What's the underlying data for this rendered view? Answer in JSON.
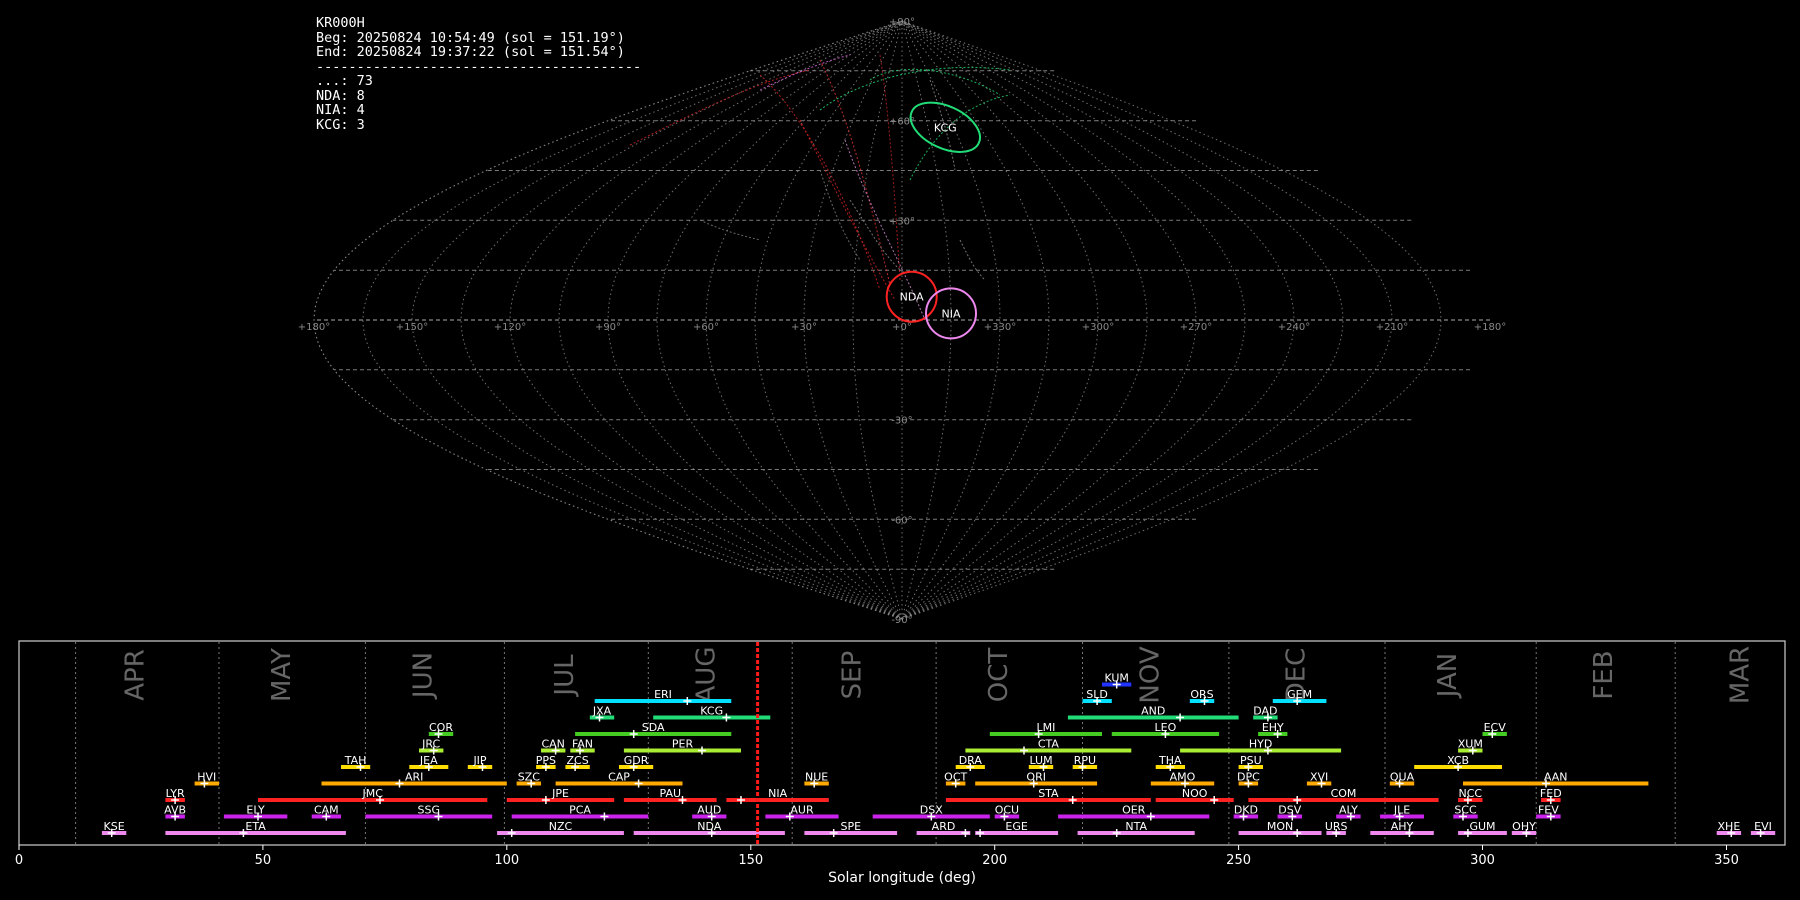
{
  "header": {
    "station": "KR000H",
    "beg": "Beg: 20250824 10:54:49 (sol = 151.19°)",
    "end": "End: 20250824 19:37:22 (sol = 151.54°)",
    "rule": "----------------------------------------",
    "counts": [
      {
        "code": "...",
        "n": "73"
      },
      {
        "code": "NDA",
        "n": "8"
      },
      {
        "code": "NIA",
        "n": "4"
      },
      {
        "code": "KCG",
        "n": "3"
      }
    ]
  },
  "chart_data": [
    {
      "type": "sky-map",
      "projection": "sinusoidal",
      "lon_ticks": [
        "+180°",
        "+150°",
        "+120°",
        "+90°",
        "+60°",
        "+30°",
        "+0°",
        "+330°",
        "+300°",
        "+270°",
        "+240°",
        "+210°",
        "+180°"
      ],
      "lat_ticks": [
        "+90°",
        "+60°",
        "+30°",
        "-30°",
        "-60°",
        "-90°"
      ],
      "radiants": [
        {
          "code": "KCG",
          "lon": 335,
          "lat": 58,
          "color": "#22dd77"
        },
        {
          "code": "NDA",
          "lon": 357,
          "lat": 7,
          "color": "#ff2222"
        },
        {
          "code": "NIA",
          "lon": 345,
          "lat": 2,
          "color": "#ee88ee"
        }
      ]
    },
    {
      "type": "timeline",
      "xlabel": "Solar longitude (deg)",
      "xlim": [
        0,
        362
      ],
      "x_ticks": [
        0,
        50,
        100,
        150,
        200,
        250,
        300,
        350
      ],
      "current_sol": 151.4,
      "months": [
        {
          "name": "APR",
          "start": 11.6,
          "center": 24
        },
        {
          "name": "MAY",
          "start": 41,
          "center": 54
        },
        {
          "name": "JUN",
          "start": 71,
          "center": 83
        },
        {
          "name": "JUL",
          "start": 99.5,
          "center": 112
        },
        {
          "name": "AUG",
          "start": 129,
          "center": 141
        },
        {
          "name": "SEP",
          "start": 158.5,
          "center": 171
        },
        {
          "name": "OCT",
          "start": 188,
          "center": 201
        },
        {
          "name": "NOV",
          "start": 218,
          "center": 232
        },
        {
          "name": "DEC",
          "start": 248,
          "center": 262
        },
        {
          "name": "JAN",
          "start": 280,
          "center": 293
        },
        {
          "name": "FEB",
          "start": 311,
          "center": 325
        },
        {
          "name": "MAR",
          "start": 339.5,
          "center": 353
        }
      ],
      "showers": [
        {
          "code": "KUM",
          "start": 222,
          "end": 228,
          "peak": 225,
          "row": 9,
          "color": "#2233ff"
        },
        {
          "code": "ERI",
          "start": 118,
          "end": 146,
          "peak": 137,
          "row": 8,
          "color": "#00e0ff"
        },
        {
          "code": "SLD",
          "start": 218,
          "end": 224,
          "peak": 221,
          "row": 8,
          "color": "#00e0ff"
        },
        {
          "code": "ORS",
          "start": 240,
          "end": 245,
          "peak": 243,
          "row": 8,
          "color": "#00e0ff"
        },
        {
          "code": "GEM",
          "start": 257,
          "end": 268,
          "peak": 262,
          "row": 8,
          "color": "#00e0ff"
        },
        {
          "code": "JXA",
          "start": 117,
          "end": 122,
          "peak": 119,
          "row": 7,
          "color": "#22dd77"
        },
        {
          "code": "KCG",
          "start": 130,
          "end": 154,
          "peak": 145,
          "row": 7,
          "color": "#22dd77"
        },
        {
          "code": "AND",
          "start": 215,
          "end": 250,
          "peak": 238,
          "row": 7,
          "color": "#22dd77"
        },
        {
          "code": "DAD",
          "start": 253,
          "end": 258,
          "peak": 256,
          "row": 7,
          "color": "#22dd77"
        },
        {
          "code": "COR",
          "start": 84,
          "end": 89,
          "peak": 86,
          "row": 6,
          "color": "#44cc22"
        },
        {
          "code": "SDA",
          "start": 114,
          "end": 146,
          "peak": 126,
          "row": 6,
          "color": "#44cc22"
        },
        {
          "code": "LMI",
          "start": 199,
          "end": 222,
          "peak": 209,
          "row": 6,
          "color": "#44cc22"
        },
        {
          "code": "LEO",
          "start": 224,
          "end": 246,
          "peak": 235,
          "row": 6,
          "color": "#44cc22"
        },
        {
          "code": "EHY",
          "start": 254,
          "end": 260,
          "peak": 258,
          "row": 6,
          "color": "#44cc22"
        },
        {
          "code": "ECV",
          "start": 300,
          "end": 305,
          "peak": 302,
          "row": 6,
          "color": "#44cc22"
        },
        {
          "code": "JRC",
          "start": 82,
          "end": 87,
          "peak": 85,
          "row": 5,
          "color": "#aaee33"
        },
        {
          "code": "CAN",
          "start": 107,
          "end": 112,
          "peak": 110,
          "row": 5,
          "color": "#aaee33"
        },
        {
          "code": "FAN",
          "start": 113,
          "end": 118,
          "peak": 115,
          "row": 5,
          "color": "#aaee33"
        },
        {
          "code": "PER",
          "start": 124,
          "end": 148,
          "peak": 140,
          "row": 5,
          "color": "#aaee33"
        },
        {
          "code": "CTA",
          "start": 194,
          "end": 228,
          "peak": 206,
          "row": 5,
          "color": "#aaee33"
        },
        {
          "code": "HYD",
          "start": 238,
          "end": 271,
          "peak": 256,
          "row": 5,
          "color": "#aaee33"
        },
        {
          "code": "XUM",
          "start": 295,
          "end": 300,
          "peak": 298,
          "row": 5,
          "color": "#aaee33"
        },
        {
          "code": "TAH",
          "start": 66,
          "end": 72,
          "peak": 70,
          "row": 4,
          "color": "#ffdd00"
        },
        {
          "code": "JEA",
          "start": 80,
          "end": 88,
          "peak": 84,
          "row": 4,
          "color": "#ffdd00"
        },
        {
          "code": "JIP",
          "start": 92,
          "end": 97,
          "peak": 95,
          "row": 4,
          "color": "#ffdd00"
        },
        {
          "code": "PPS",
          "start": 106,
          "end": 110,
          "peak": 108,
          "row": 4,
          "color": "#ffdd00"
        },
        {
          "code": "ZCS",
          "start": 112,
          "end": 117,
          "peak": 114,
          "row": 4,
          "color": "#ffdd00"
        },
        {
          "code": "GDR",
          "start": 123,
          "end": 130,
          "peak": 126,
          "row": 4,
          "color": "#ffdd00"
        },
        {
          "code": "DRA",
          "start": 192,
          "end": 198,
          "peak": 195,
          "row": 4,
          "color": "#ffdd00"
        },
        {
          "code": "LUM",
          "start": 207,
          "end": 212,
          "peak": 210,
          "row": 4,
          "color": "#ffdd00"
        },
        {
          "code": "RPU",
          "start": 216,
          "end": 221,
          "peak": 218,
          "row": 4,
          "color": "#ffdd00"
        },
        {
          "code": "THA",
          "start": 233,
          "end": 239,
          "peak": 236,
          "row": 4,
          "color": "#ffdd00"
        },
        {
          "code": "PSU",
          "start": 250,
          "end": 255,
          "peak": 252,
          "row": 4,
          "color": "#ffdd00"
        },
        {
          "code": "XCB",
          "start": 286,
          "end": 304,
          "peak": 295,
          "row": 4,
          "color": "#ffdd00"
        },
        {
          "code": "HVI",
          "start": 36,
          "end": 41,
          "peak": 38,
          "row": 3,
          "color": "#ffaa00"
        },
        {
          "code": "ARI",
          "start": 62,
          "end": 100,
          "peak": 78,
          "row": 3,
          "color": "#ffaa00"
        },
        {
          "code": "SZC",
          "start": 102,
          "end": 107,
          "peak": 105,
          "row": 3,
          "color": "#ffaa00"
        },
        {
          "code": "CAP",
          "start": 110,
          "end": 136,
          "peak": 127,
          "row": 3,
          "color": "#ffaa00"
        },
        {
          "code": "NUE",
          "start": 161,
          "end": 166,
          "peak": 163,
          "row": 3,
          "color": "#ffaa00"
        },
        {
          "code": "OCT",
          "start": 190,
          "end": 194,
          "peak": 192,
          "row": 3,
          "color": "#ffaa00"
        },
        {
          "code": "ORI",
          "start": 196,
          "end": 221,
          "peak": 208,
          "row": 3,
          "color": "#ffaa00"
        },
        {
          "code": "AMO",
          "start": 232,
          "end": 245,
          "peak": 239,
          "row": 3,
          "color": "#ffaa00"
        },
        {
          "code": "DPC",
          "start": 250,
          "end": 254,
          "peak": 252,
          "row": 3,
          "color": "#ffaa00"
        },
        {
          "code": "XVI",
          "start": 264,
          "end": 269,
          "peak": 267,
          "row": 3,
          "color": "#ffaa00"
        },
        {
          "code": "QUA",
          "start": 281,
          "end": 286,
          "peak": 283,
          "row": 3,
          "color": "#ffaa00"
        },
        {
          "code": "AAN",
          "start": 296,
          "end": 334,
          "peak": 313,
          "row": 3,
          "color": "#ffaa00"
        },
        {
          "code": "LYR",
          "start": 30,
          "end": 34,
          "peak": 32,
          "row": 2,
          "color": "#ff2222"
        },
        {
          "code": "JMC",
          "start": 49,
          "end": 96,
          "peak": 74,
          "row": 2,
          "color": "#ff2222"
        },
        {
          "code": "JPE",
          "start": 100,
          "end": 122,
          "peak": 108,
          "row": 2,
          "color": "#ff2222"
        },
        {
          "code": "PAU",
          "start": 124,
          "end": 143,
          "peak": 136,
          "row": 2,
          "color": "#ff2222"
        },
        {
          "code": "NIA",
          "start": 145,
          "end": 166,
          "peak": 148,
          "row": 2,
          "color": "#ff2222"
        },
        {
          "code": "STA",
          "start": 190,
          "end": 232,
          "peak": 216,
          "row": 2,
          "color": "#ff2222"
        },
        {
          "code": "NOO",
          "start": 233,
          "end": 249,
          "peak": 245,
          "row": 2,
          "color": "#ff2222"
        },
        {
          "code": "COM",
          "start": 252,
          "end": 291,
          "peak": 262,
          "row": 2,
          "color": "#ff2222"
        },
        {
          "code": "NCC",
          "start": 295,
          "end": 300,
          "peak": 297,
          "row": 2,
          "color": "#ff2222"
        },
        {
          "code": "FED",
          "start": 312,
          "end": 316,
          "peak": 314,
          "row": 2,
          "color": "#ff2222"
        },
        {
          "code": "AVB",
          "start": 30,
          "end": 34,
          "peak": 32,
          "row": 1,
          "color": "#cc22ee"
        },
        {
          "code": "ELY",
          "start": 42,
          "end": 55,
          "peak": 49,
          "row": 1,
          "color": "#cc22ee"
        },
        {
          "code": "CAM",
          "start": 60,
          "end": 66,
          "peak": 63,
          "row": 1,
          "color": "#cc22ee"
        },
        {
          "code": "SSG",
          "start": 71,
          "end": 97,
          "peak": 86,
          "row": 1,
          "color": "#cc22ee"
        },
        {
          "code": "PCA",
          "start": 101,
          "end": 129,
          "peak": 120,
          "row": 1,
          "color": "#cc22ee"
        },
        {
          "code": "AUD",
          "start": 138,
          "end": 145,
          "peak": 142,
          "row": 1,
          "color": "#cc22ee"
        },
        {
          "code": "AUR",
          "start": 153,
          "end": 168,
          "peak": 158,
          "row": 1,
          "color": "#cc22ee"
        },
        {
          "code": "DSX",
          "start": 175,
          "end": 199,
          "peak": 187,
          "row": 1,
          "color": "#cc22ee"
        },
        {
          "code": "OCU",
          "start": 200,
          "end": 205,
          "peak": 202,
          "row": 1,
          "color": "#cc22ee"
        },
        {
          "code": "OER",
          "start": 213,
          "end": 244,
          "peak": 232,
          "row": 1,
          "color": "#cc22ee"
        },
        {
          "code": "DKD",
          "start": 249,
          "end": 254,
          "peak": 251,
          "row": 1,
          "color": "#cc22ee"
        },
        {
          "code": "DSV",
          "start": 258,
          "end": 263,
          "peak": 261,
          "row": 1,
          "color": "#cc22ee"
        },
        {
          "code": "ALY",
          "start": 270,
          "end": 275,
          "peak": 273,
          "row": 1,
          "color": "#cc22ee"
        },
        {
          "code": "JLE",
          "start": 279,
          "end": 288,
          "peak": 283,
          "row": 1,
          "color": "#cc22ee"
        },
        {
          "code": "SCC",
          "start": 294,
          "end": 299,
          "peak": 296,
          "row": 1,
          "color": "#cc22ee"
        },
        {
          "code": "FEV",
          "start": 311,
          "end": 316,
          "peak": 314,
          "row": 1,
          "color": "#cc22ee"
        },
        {
          "code": "KSE",
          "start": 17,
          "end": 22,
          "peak": 19,
          "row": 0,
          "color": "#ee88ee"
        },
        {
          "code": "ETA",
          "start": 30,
          "end": 67,
          "peak": 46,
          "row": 0,
          "color": "#ee88ee"
        },
        {
          "code": "NZC",
          "start": 98,
          "end": 124,
          "peak": 101,
          "row": 0,
          "color": "#ee88ee"
        },
        {
          "code": "NDA",
          "start": 126,
          "end": 157,
          "peak": 142,
          "row": 0,
          "color": "#ee88ee"
        },
        {
          "code": "SPE",
          "start": 161,
          "end": 180,
          "peak": 167,
          "row": 0,
          "color": "#ee88ee"
        },
        {
          "code": "ARD",
          "start": 184,
          "end": 195,
          "peak": 194,
          "row": 0,
          "color": "#ee88ee"
        },
        {
          "code": "EGE",
          "start": 196,
          "end": 213,
          "peak": 197,
          "row": 0,
          "color": "#ee88ee"
        },
        {
          "code": "NTA",
          "start": 217,
          "end": 241,
          "peak": 225,
          "row": 0,
          "color": "#ee88ee"
        },
        {
          "code": "MON",
          "start": 250,
          "end": 267,
          "peak": 262,
          "row": 0,
          "color": "#ee88ee"
        },
        {
          "code": "URS",
          "start": 268,
          "end": 272,
          "peak": 270,
          "row": 0,
          "color": "#ee88ee"
        },
        {
          "code": "AHY",
          "start": 277,
          "end": 290,
          "peak": 285,
          "row": 0,
          "color": "#ee88ee"
        },
        {
          "code": "GUM",
          "start": 295,
          "end": 305,
          "peak": 297,
          "row": 0,
          "color": "#ee88ee"
        },
        {
          "code": "OHY",
          "start": 306,
          "end": 311,
          "peak": 309,
          "row": 0,
          "color": "#ee88ee"
        },
        {
          "code": "XHE",
          "start": 348,
          "end": 353,
          "peak": 351,
          "row": 0,
          "color": "#ee88ee"
        },
        {
          "code": "EVI",
          "start": 355,
          "end": 360,
          "peak": 357,
          "row": 0,
          "color": "#ee88ee"
        }
      ]
    }
  ]
}
